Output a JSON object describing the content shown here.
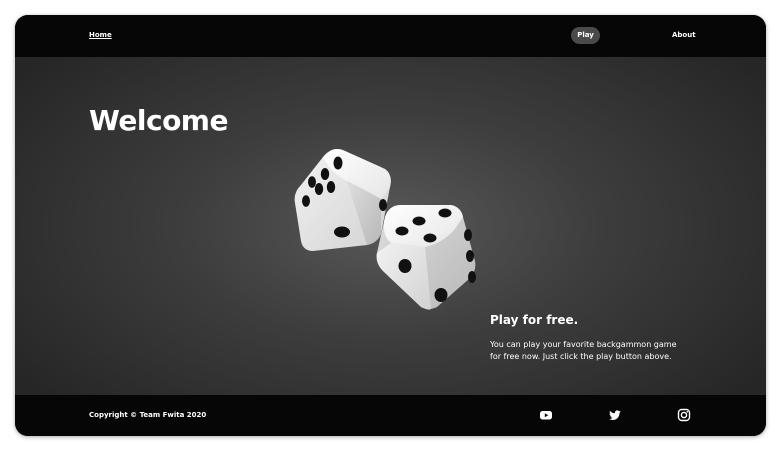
{
  "nav": {
    "home_label": "Home",
    "play_label": "Play",
    "about_label": "About"
  },
  "hero": {
    "title": "Welcome",
    "subtitle": "Play for free.",
    "description": "You can play your favorite backgammon game for free now. Just click the play button above.",
    "image_icon": "dice-icon"
  },
  "footer": {
    "copyright": "Copyright © Team Fwita 2020",
    "social": [
      {
        "name": "youtube-icon"
      },
      {
        "name": "twitter-icon"
      },
      {
        "name": "instagram-icon"
      }
    ]
  },
  "colors": {
    "background": "#0a0a0a",
    "nav_play_bg": "#4a4a4a",
    "text": "#ffffff"
  }
}
